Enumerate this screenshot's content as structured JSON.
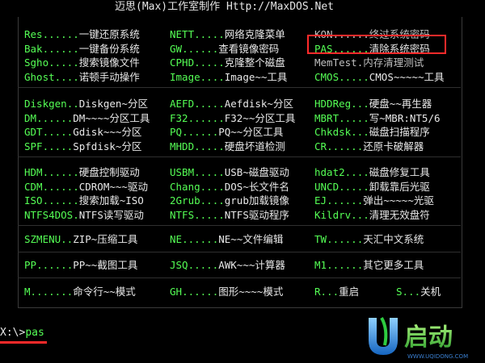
{
  "title": "迈思(Max)工作室制作 Http://MaxDOS.Net",
  "groups": [
    {
      "rows": [
        [
          {
            "key": "Res",
            "dots": "......",
            "desc": "一键还原系统"
          },
          {
            "key": "NETT",
            "dots": ".....",
            "desc": "网络克隆菜单"
          },
          {
            "key": "KON",
            "dots": "......",
            "desc": "终过系统密码"
          }
        ],
        [
          {
            "key": "Bak",
            "dots": "......",
            "desc": "一键备份系统"
          },
          {
            "key": "GW",
            "dots": "......",
            "desc": "查看镜像密码"
          },
          {
            "key": "PAS",
            "dots": "......",
            "desc": "清除系统密码"
          }
        ],
        [
          {
            "key": "Sgho",
            "dots": ".....",
            "desc": "搜索镜像文件"
          },
          {
            "key": "CPHD",
            "dots": ".....",
            "desc": "克隆整个磁盘"
          },
          {
            "key": "MemTest",
            "dots": ".",
            "desc": "内存清理测试"
          }
        ],
        [
          {
            "key": "Ghost",
            "dots": "....",
            "desc": "诺顿手动操作"
          },
          {
            "key": "Image",
            "dots": "....",
            "desc": "Image~~工具"
          },
          {
            "key": "CMOS",
            "dots": ".....",
            "desc": "CMOS~~~~~工具"
          }
        ]
      ]
    },
    {
      "rows": [
        [
          {
            "key": "Diskgen",
            "dots": "..",
            "desc": "Diskgen~分区"
          },
          {
            "key": "AEFD",
            "dots": ".....",
            "desc": "Aefdisk~分区"
          },
          {
            "key": "HDDReg",
            "dots": "...",
            "desc": "硬盘~~再生器"
          }
        ],
        [
          {
            "key": "DM",
            "dots": "......",
            "desc": "DM~~~~分区工具"
          },
          {
            "key": "F32",
            "dots": "......",
            "desc": "F32~~分区工具"
          },
          {
            "key": "MBRT",
            "dots": ".....",
            "desc": "写~MBR:NT5/6"
          }
        ],
        [
          {
            "key": "GDT",
            "dots": ".....",
            "desc": "Gdisk~~~分区"
          },
          {
            "key": "PQ",
            "dots": "......",
            "desc": "PQ~~分区工具"
          },
          {
            "key": "Chkdsk",
            "dots": "...",
            "desc": "磁盘扫描程序"
          }
        ],
        [
          {
            "key": "SPF",
            "dots": ".....",
            "desc": "Spfdisk~分区"
          },
          {
            "key": "MHDD",
            "dots": ".....",
            "desc": "硬盘坏道检测"
          },
          {
            "key": "CR",
            "dots": "......",
            "desc": "还原卡破解器"
          }
        ]
      ]
    },
    {
      "rows": [
        [
          {
            "key": "HDM",
            "dots": "......",
            "desc": "硬盘控制驱动"
          },
          {
            "key": "USBM",
            "dots": ".....",
            "desc": "USB~磁盘驱动"
          },
          {
            "key": "hdat2",
            "dots": "....",
            "desc": "磁盘修复工具"
          }
        ],
        [
          {
            "key": "CDM",
            "dots": "......",
            "desc": "CDROM~~~驱动"
          },
          {
            "key": "Chang",
            "dots": "....",
            "desc": "DOS~长文件名"
          },
          {
            "key": "UNCD",
            "dots": ".....",
            "desc": "卸载靠后光驱"
          }
        ],
        [
          {
            "key": "ISO",
            "dots": "......",
            "desc": "搜索加载~ISO"
          },
          {
            "key": "2Grub",
            "dots": "....",
            "desc": "grub加载镜像"
          },
          {
            "key": "EJ",
            "dots": "......",
            "desc": "弹出~~~~~光驱"
          }
        ],
        [
          {
            "key": "NTFS4DOS",
            "dots": ".",
            "desc": "NTFS读写驱动"
          },
          {
            "key": "NTFS",
            "dots": ".....",
            "desc": "NTFS驱动程序"
          },
          {
            "key": "Kildrv",
            "dots": "...",
            "desc": "清理无效盘符"
          }
        ]
      ]
    },
    {
      "rows": [
        [
          {
            "key": "SZMENU",
            "dots": "..",
            "desc": "ZIP~压缩工具"
          },
          {
            "key": "NE",
            "dots": "......",
            "desc": "NE~~文件编辑"
          },
          {
            "key": "TW",
            "dots": "......",
            "desc": "天汇中文系统"
          }
        ]
      ]
    },
    {
      "rows": [
        [
          {
            "key": "PP",
            "dots": "......",
            "desc": "PP~~截图工具"
          },
          {
            "key": "JSQ",
            "dots": ".....",
            "desc": "AWK~~~计算器"
          },
          {
            "key": "M1",
            "dots": "......",
            "desc": "其它更多工具"
          }
        ]
      ]
    },
    {
      "rows": [
        [
          {
            "key": "M",
            "dots": ".......",
            "desc": "命令行~~模式"
          },
          {
            "key": "GH",
            "dots": "......",
            "desc": "图形~~~~模式"
          },
          {
            "key": "R",
            "dots": "...",
            "desc": "重启"
          },
          {
            "key": "S",
            "dots": "...",
            "desc": "关机"
          }
        ]
      ]
    }
  ],
  "prompt": {
    "path": "X:\\>",
    "command": "pas"
  },
  "logo": {
    "text": "启动",
    "url_text": "WWW.UQIDONG.COM"
  }
}
